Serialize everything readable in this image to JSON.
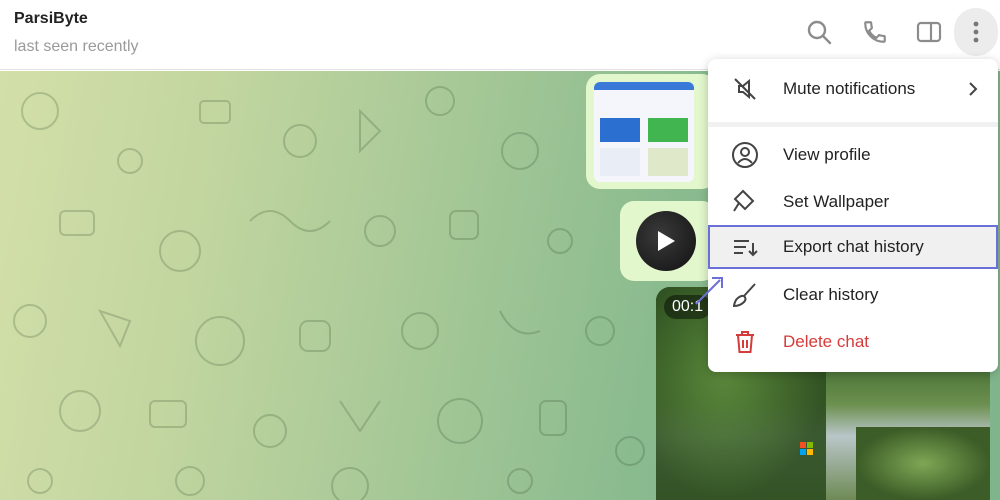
{
  "header": {
    "title": "ParsiByte",
    "subtitle": "last seen recently"
  },
  "icons": {
    "search": "search-icon",
    "call": "phone-icon",
    "sidebar": "sidebar-toggle-icon",
    "more": "more-vertical-icon"
  },
  "colors": {
    "accent": "#6b6fd8",
    "danger": "#d63b3b",
    "bubble": "#e2f7cc"
  },
  "menu": {
    "items": [
      {
        "label": "Mute notifications",
        "icon": "mute-icon"
      },
      {
        "label": "View profile",
        "icon": "profile-icon"
      },
      {
        "label": "Set Wallpaper",
        "icon": "paint-bucket-icon"
      },
      {
        "label": "Export chat history",
        "icon": "export-list-icon"
      },
      {
        "label": "Clear history",
        "icon": "broom-icon"
      },
      {
        "label": "Delete chat",
        "icon": "trash-icon"
      }
    ]
  },
  "messages": {
    "video_duration": "00:1"
  }
}
